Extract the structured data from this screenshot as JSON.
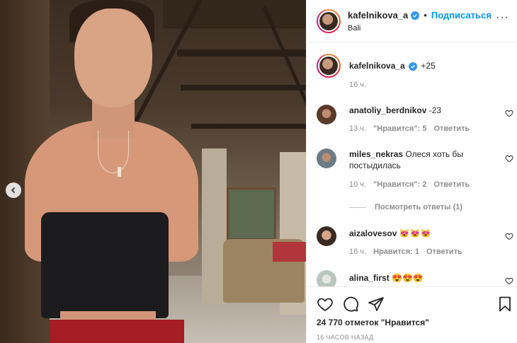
{
  "header": {
    "username": "kafelnikova_a",
    "separator": "•",
    "follow_label": "Подписаться",
    "location": "Bali",
    "more_icon": "more-options-icon"
  },
  "caption": {
    "username": "kafelnikova_a",
    "text": "+25",
    "time": "16 ч."
  },
  "comments": [
    {
      "username": "anatoliy_berdnikov",
      "text": "-23",
      "time": "13 ч.",
      "likes_label": "\"Нравится\": 5",
      "reply_label": "Ответить"
    },
    {
      "username": "miles_nekras",
      "text": "Олеся хоть бы постыдилась",
      "time": "10 ч.",
      "likes_label": "\"Нравится\": 2",
      "reply_label": "Ответить",
      "view_replies": "Посмотреть ответы (1)"
    },
    {
      "username": "aizalovesov",
      "text": "😻😻😻",
      "time": "16 ч.",
      "likes_label": "Нравится: 1",
      "reply_label": "Ответить"
    },
    {
      "username": "alina_first",
      "text": "😍😍😍"
    }
  ],
  "footer": {
    "likes_text": "24 770 отметок \"Нравится\"",
    "time_ago": "16 ЧАСОВ НАЗАД"
  },
  "colors": {
    "accent": "#0095f6",
    "verified": "#3897f0",
    "muted": "#8e8e8e",
    "text": "#262626"
  }
}
